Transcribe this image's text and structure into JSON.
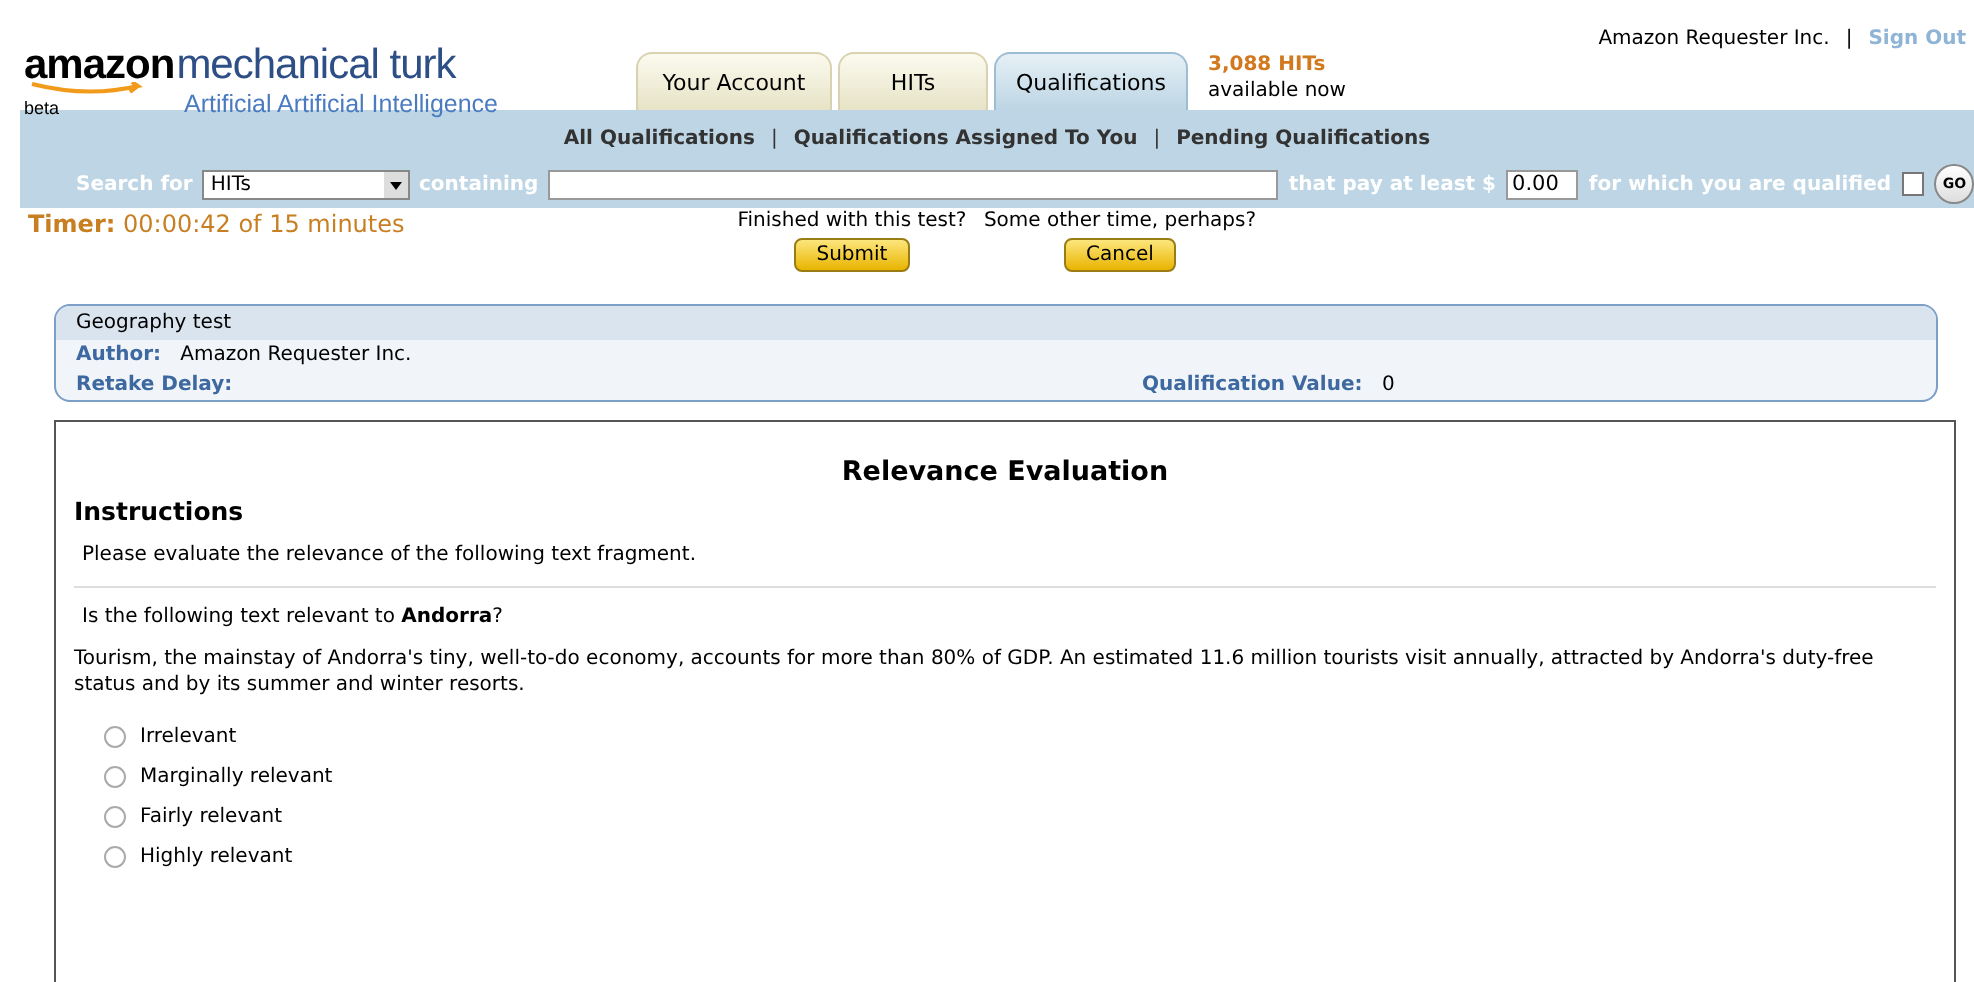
{
  "logo": {
    "brand": "amazon",
    "product": "mechanical turk",
    "tagline": "Artificial Artificial Intelligence",
    "badge": "beta"
  },
  "tabs": [
    {
      "label": "Your Account",
      "selected": false
    },
    {
      "label": "HITs",
      "selected": false
    },
    {
      "label": "Qualifications",
      "selected": true
    }
  ],
  "hits_count": {
    "count": "3,088 HITs",
    "note": "available now"
  },
  "user": {
    "name": "Amazon Requester Inc.",
    "separator": "|",
    "sign_out": "Sign Out"
  },
  "sub_nav": {
    "links": [
      "All Qualifications",
      "Qualifications Assigned To You",
      "Pending Qualifications"
    ],
    "separator": "|"
  },
  "search": {
    "label": "Search for",
    "type_value": "HITs",
    "containing": "containing",
    "pay_label": "that pay at least $",
    "pay_value": "0.00",
    "qualified_label": "for which you are qualified",
    "qualified_checked": false,
    "go": "GO"
  },
  "timer": {
    "label": "Timer:",
    "value": "00:00:42 of 15 minutes"
  },
  "actions": [
    {
      "prompt": "Finished with this test?",
      "button": "Submit"
    },
    {
      "prompt": "Some other time, perhaps?",
      "button": "Cancel"
    }
  ],
  "test_info": {
    "title": "Geography test",
    "author_label": "Author:",
    "author": "Amazon Requester Inc.",
    "retake_label": "Retake Delay:",
    "value_label": "Qualification Value:",
    "value": "0"
  },
  "question": {
    "title": "Relevance Evaluation",
    "instructions_heading": "Instructions",
    "instructions": "Please evaluate the relevance of the following text fragment.",
    "prompt": "Is the following text relevant to **Andorra**?",
    "passage": "Tourism, the mainstay of Andorra's tiny, well-to-do economy, accounts for more than 80% of GDP. An estimated 11.6 million tourists visit annually, attracted by Andorra's duty-free status and by its summer and winter resorts.",
    "options": [
      {
        "label": "Irrelevant",
        "selected": false
      },
      {
        "label": "Marginally relevant",
        "selected": false
      },
      {
        "label": "Fairly relevant",
        "selected": false
      },
      {
        "label": "Highly relevant",
        "selected": false
      }
    ]
  }
}
